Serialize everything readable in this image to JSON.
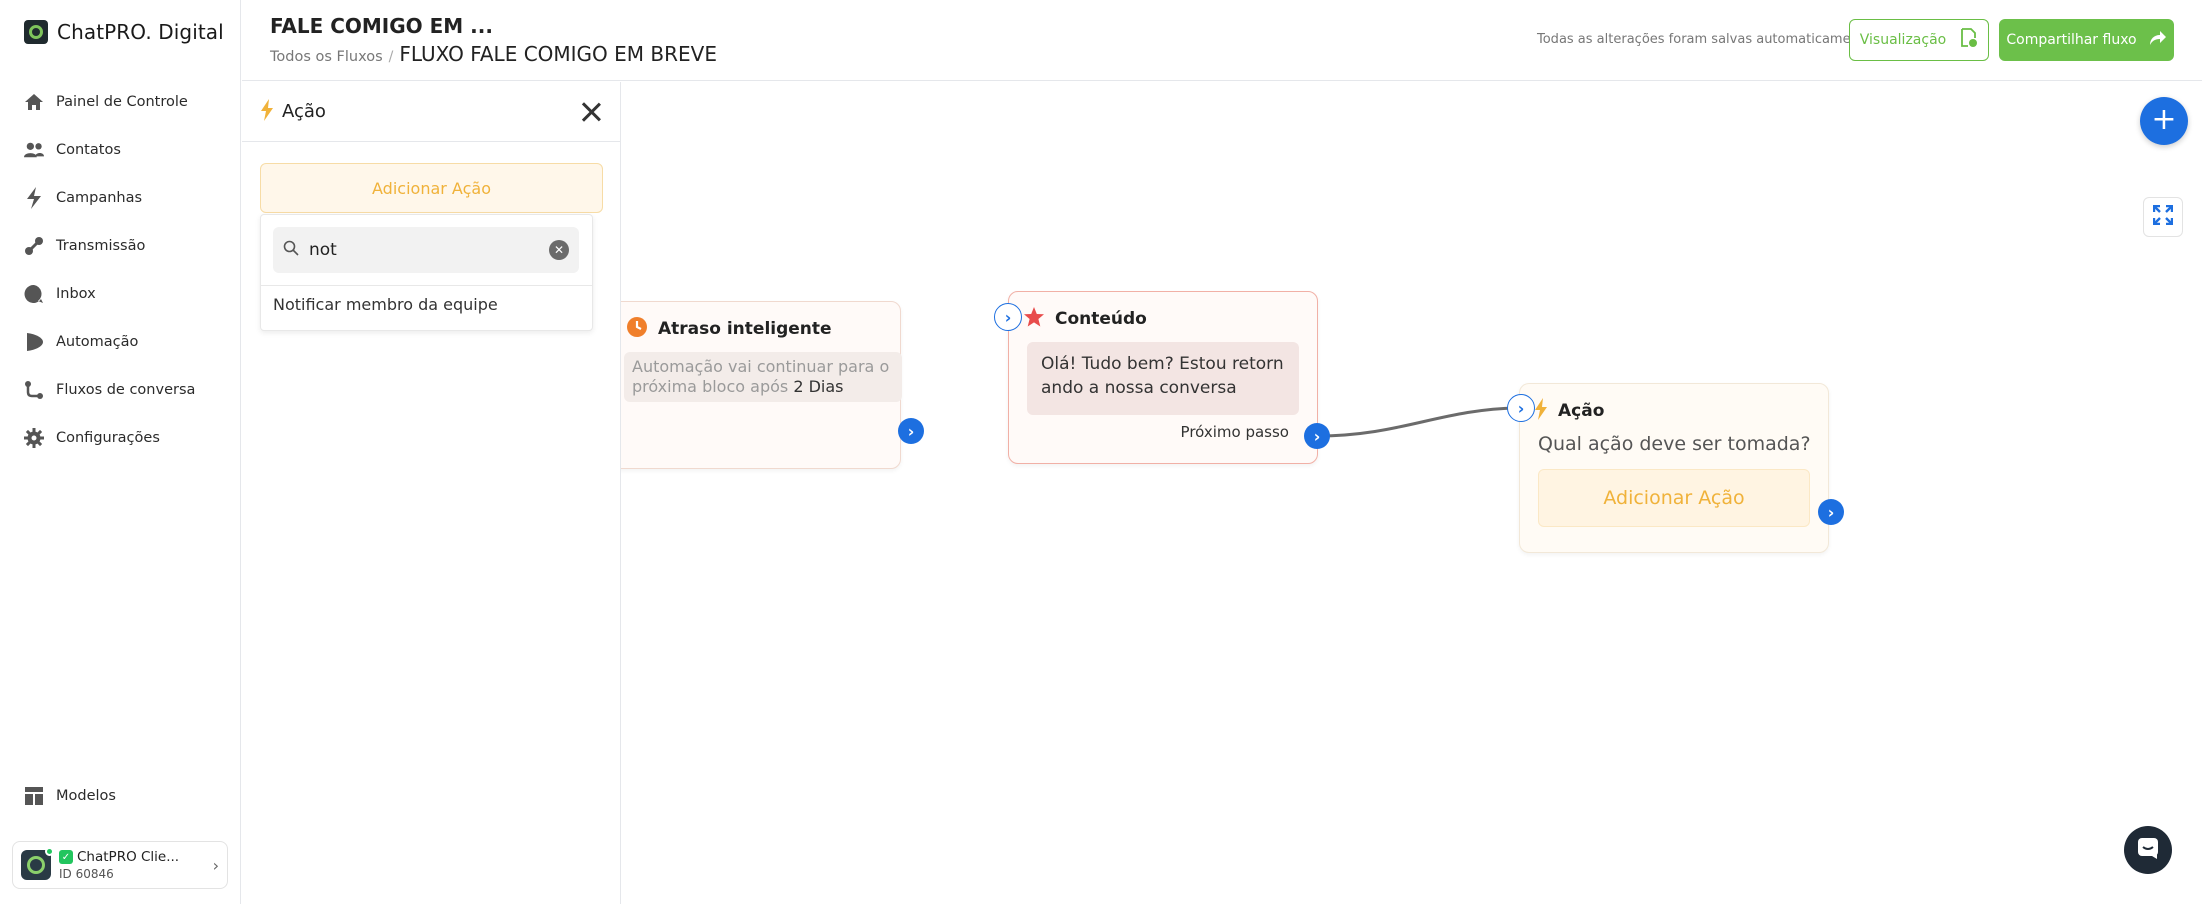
{
  "brand": {
    "name": "ChatPRO. Digital"
  },
  "sidebar": {
    "items": [
      {
        "label": "Painel de Controle",
        "icon": "home-icon"
      },
      {
        "label": "Contatos",
        "icon": "users-icon"
      },
      {
        "label": "Campanhas",
        "icon": "bolt-icon"
      },
      {
        "label": "Transmissão",
        "icon": "broadcast-icon"
      },
      {
        "label": "Inbox",
        "icon": "chat-bubble-icon"
      },
      {
        "label": "Automação",
        "icon": "play-icon"
      },
      {
        "label": "Fluxos de conversa",
        "icon": "flow-icon"
      },
      {
        "label": "Configurações",
        "icon": "gear-icon"
      }
    ],
    "bottom": {
      "label": "Modelos",
      "icon": "template-icon"
    },
    "account": {
      "name": "ChatPRO Clie...",
      "id": "ID 60846"
    }
  },
  "header": {
    "title": "FALE COMIGO EM ...",
    "breadcrumb_link": "Todos os Fluxos",
    "breadcrumb_sep": "/",
    "breadcrumb_current": "FLUXO FALE COMIGO EM BREVE",
    "autosave": "Todas as alterações foram salvas automaticamente",
    "preview_label": "Visualização",
    "share_label": "Compartilhar fluxo"
  },
  "panel": {
    "title": "Ação",
    "add_action_label": "Adicionar Ação",
    "search": {
      "value": "not",
      "placeholder": ""
    },
    "options": [
      "Notificar membro da equipe"
    ]
  },
  "canvas": {
    "delay_node": {
      "title": "Atraso inteligente",
      "text": "Automação vai continuar para o próxima bloco após",
      "duration": "2 Dias"
    },
    "content_node": {
      "title": "Conteúdo",
      "message": "Olá! Tudo bem? Estou retornando a nossa conversa",
      "next_label": "Próximo passo"
    },
    "action_node": {
      "title": "Ação",
      "question": "Qual ação deve ser tomada?",
      "add_label": "Adicionar Ação"
    },
    "fab_label": "+"
  },
  "colors": {
    "accent_green": "#6cc04a",
    "port_blue": "#1d6fe0",
    "action_orange": "#f0b23a",
    "content_red": "#e84c4c"
  }
}
